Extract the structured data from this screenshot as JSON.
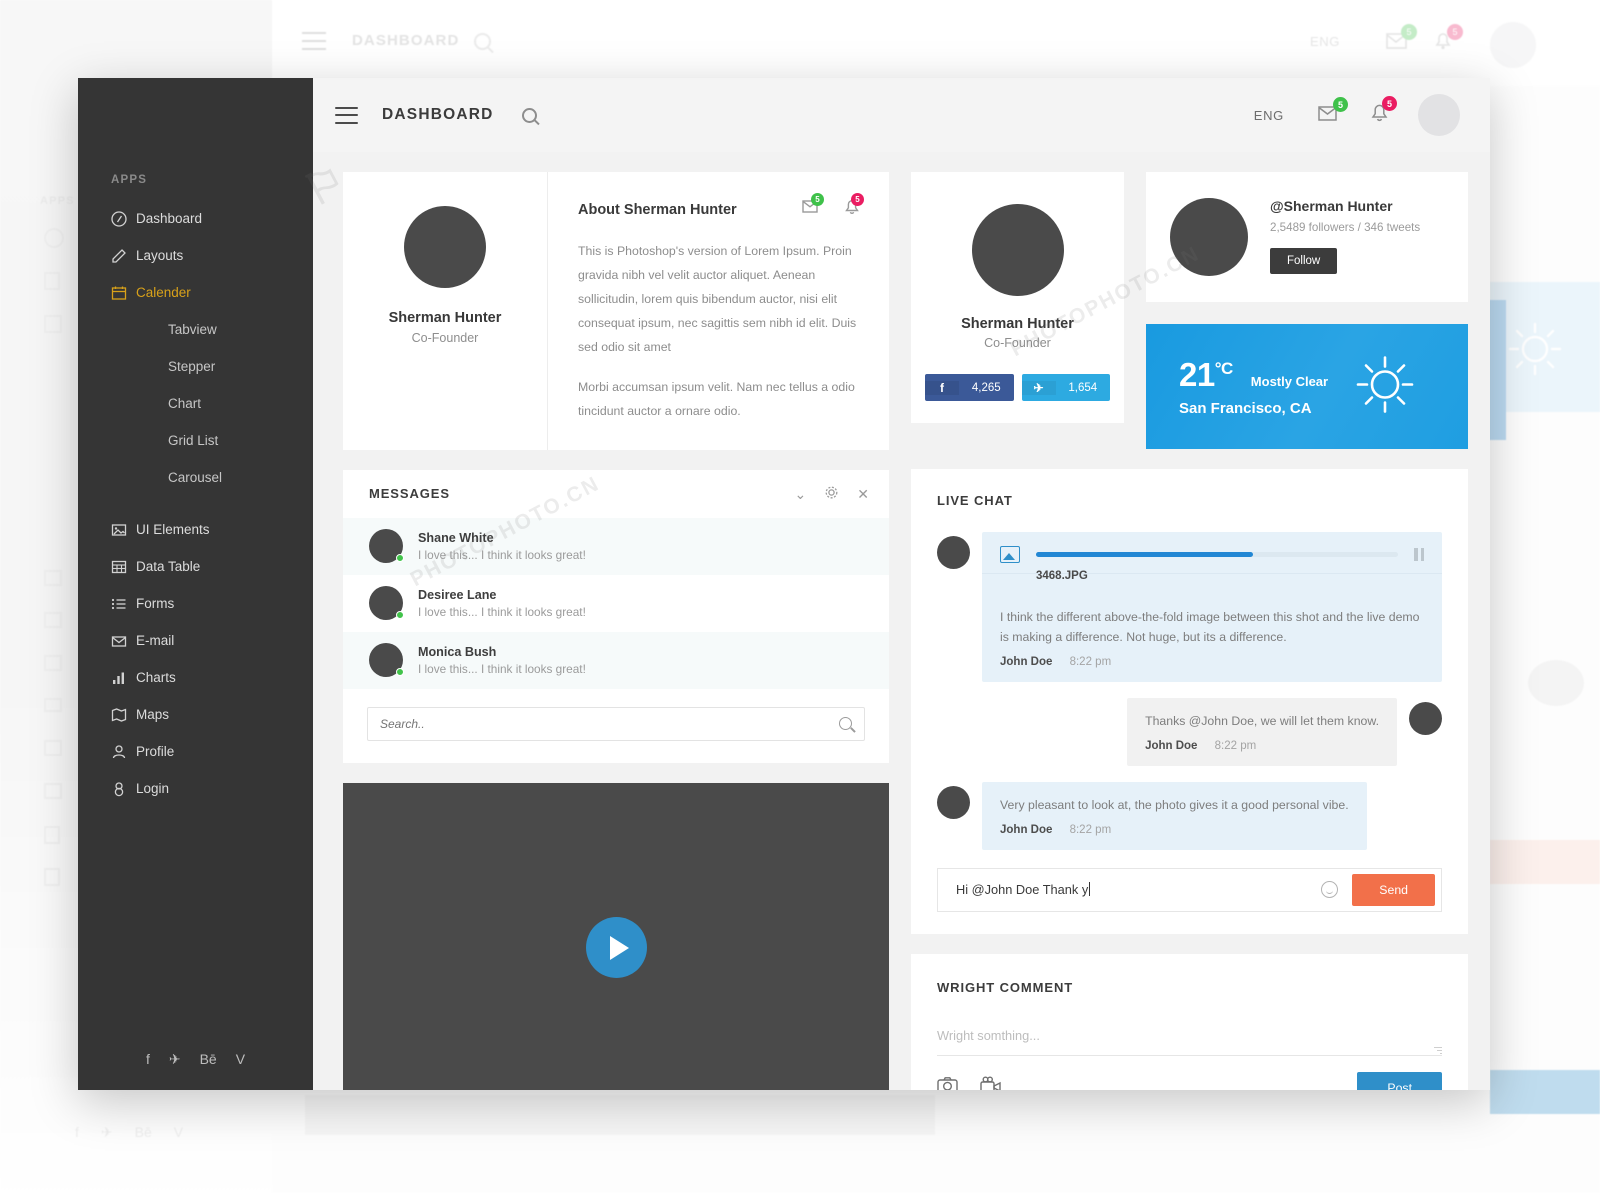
{
  "header": {
    "title": "DASHBOARD",
    "language": "ENG",
    "mail_badge": "5",
    "bell_badge": "5",
    "search_icon": "search-icon",
    "menu_icon": "hamburger-icon"
  },
  "sidebar": {
    "section_label": "APPS",
    "items": [
      {
        "label": "Dashboard",
        "icon": "dashboard-icon",
        "active": false
      },
      {
        "label": "Layouts",
        "icon": "pencil-icon",
        "active": false
      },
      {
        "label": "Calender",
        "icon": "calendar-icon",
        "active": true
      }
    ],
    "sub_items": [
      {
        "label": "Tabview"
      },
      {
        "label": "Stepper"
      },
      {
        "label": "Chart"
      },
      {
        "label": "Grid List"
      },
      {
        "label": "Carousel"
      }
    ],
    "items2": [
      {
        "label": "UI Elements",
        "icon": "image-icon"
      },
      {
        "label": "Data Table",
        "icon": "table-icon"
      },
      {
        "label": "Forms",
        "icon": "list-icon"
      },
      {
        "label": "E-mail",
        "icon": "envelope-icon"
      },
      {
        "label": "Charts",
        "icon": "bar-chart-icon"
      },
      {
        "label": "Maps",
        "icon": "map-icon"
      },
      {
        "label": "Profile",
        "icon": "user-icon"
      },
      {
        "label": "Login",
        "icon": "lock-icon"
      }
    ],
    "social": [
      {
        "label": "f",
        "name": "facebook-icon"
      },
      {
        "label": "✈",
        "name": "twitter-icon"
      },
      {
        "label": "Bē",
        "name": "behance-icon"
      },
      {
        "label": "V",
        "name": "vimeo-icon"
      }
    ],
    "accent_color": "#d8a11a",
    "background_color": "#353535"
  },
  "profile_card": {
    "name": "Sherman Hunter",
    "role": "Co-Founder"
  },
  "about": {
    "title": "About Sherman Hunter",
    "paragraph1": "This is Photoshop's version  of Lorem Ipsum. Proin gravida nibh vel velit auctor aliquet. Aenean sollicitudin, lorem quis bibendum auctor, nisi elit consequat ipsum, nec sagittis sem nibh id elit. Duis sed odio sit amet",
    "paragraph2": "Morbi accumsan ipsum velit. Nam nec tellus a odio tincidunt auctor a ornare odio.",
    "mail_badge": "5",
    "bell_badge": "5"
  },
  "messages": {
    "title": "MESSAGES",
    "search_placeholder": "Search..",
    "items": [
      {
        "name": "Shane White",
        "text": "I love this... I think it looks great!",
        "online": true
      },
      {
        "name": "Desiree Lane",
        "text": "I love this... I think it looks great!",
        "online": true
      },
      {
        "name": "Monica Bush",
        "text": "I love this... I think it looks great!",
        "online": true
      }
    ]
  },
  "profile_card2": {
    "name": "Sherman Hunter",
    "role": "Co-Founder",
    "facebook_label": "f",
    "facebook_count": "4,265",
    "twitter_label": "✈",
    "twitter_count": "1,654",
    "facebook_color": "#3b5998",
    "twitter_color": "#2daae1"
  },
  "twitter_card": {
    "handle": "@Sherman Hunter",
    "stats": "2,5489 followers / 346 tweets",
    "follow_label": "Follow"
  },
  "weather": {
    "temperature": "21",
    "unit": "°C",
    "condition": "Mostly Clear",
    "location": "San Francisco, CA",
    "icon": "sun-icon",
    "color": "#1f9ee1"
  },
  "live_chat": {
    "title": "LIVE CHAT",
    "upload": {
      "filename": "3468.JPG",
      "progress_percent": 60,
      "pause_icon": "pause-icon",
      "image_icon": "image-icon"
    },
    "messages": [
      {
        "text": "I think the different above-the-fold image between this shot and the live demo is making a difference. Not huge, but its a difference.",
        "author": "John Doe",
        "time": "8:22 pm",
        "side": "left"
      },
      {
        "text": "Thanks @John Doe, we will let them know.",
        "author": "John Doe",
        "time": "8:22 pm",
        "side": "right"
      },
      {
        "text": "Very pleasant to look at, the photo gives it a good personal vibe.",
        "author": "John Doe",
        "time": "8:22 pm",
        "side": "left"
      }
    ],
    "input_value": "Hi @John Doe Thank y",
    "send_label": "Send",
    "send_color": "#f2704a",
    "emoji_icon": "smiley-icon"
  },
  "comment": {
    "title": "WRIGHT COMMENT",
    "placeholder": "Wright somthing...",
    "post_label": "Post",
    "post_color": "#2f8fc9",
    "camera_icon": "camera-icon",
    "video_icon": "video-camera-icon"
  },
  "video": {
    "play_icon": "play-icon"
  },
  "watermarks": {
    "w1": "PHOTOPHOTO.CN",
    "w2": "PHOTOPHOTO.CN"
  }
}
